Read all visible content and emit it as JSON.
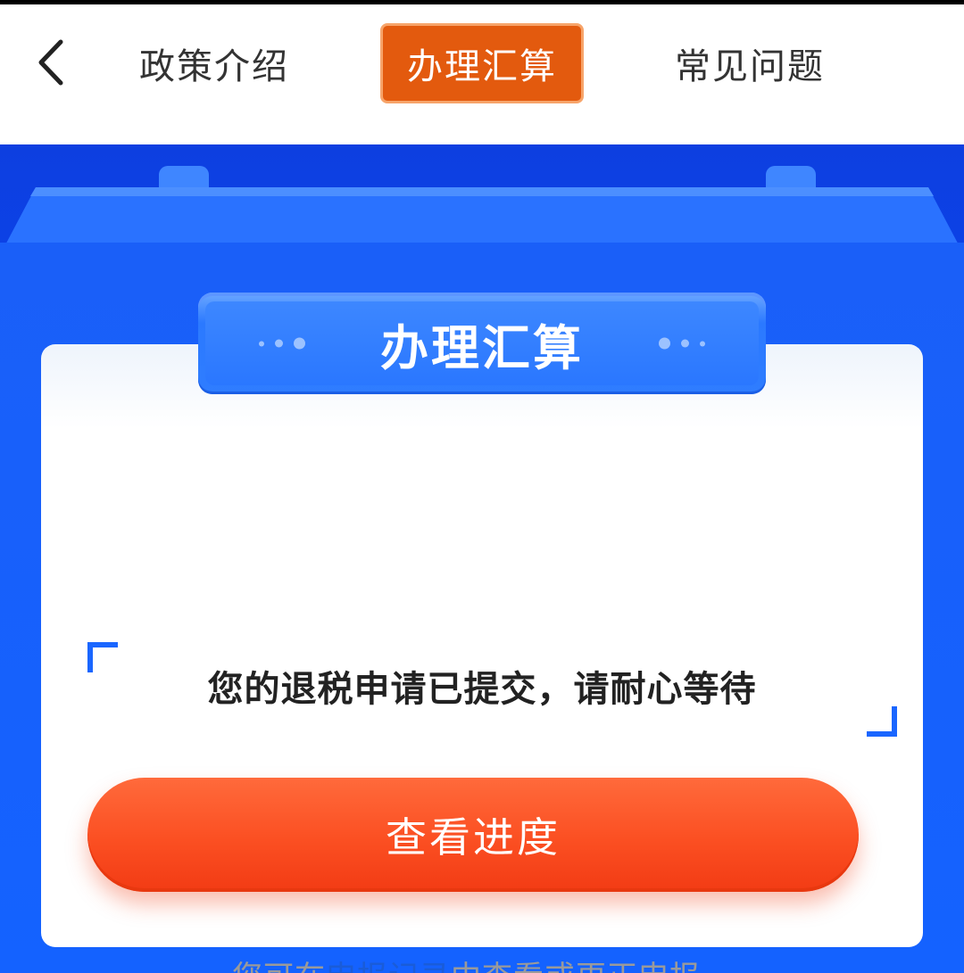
{
  "header": {
    "back_icon": "chevron-left-icon",
    "tabs": [
      {
        "label": "政策介绍"
      },
      {
        "label": "办理汇算"
      },
      {
        "label": "常见问题"
      }
    ],
    "active_tab_color": "#e35a0e"
  },
  "card": {
    "title": "办理汇算",
    "status_message": "您的退税申请已提交，请耐心等待",
    "progress_button_label": "查看进度",
    "hint_prefix": "您可在",
    "hint_link": "申报记录",
    "hint_suffix": "中查看或更正申报。"
  },
  "colors": {
    "brand_blue": "#1462ff",
    "button_orange": "#fb4f22",
    "link_blue": "#1a5cd8"
  }
}
